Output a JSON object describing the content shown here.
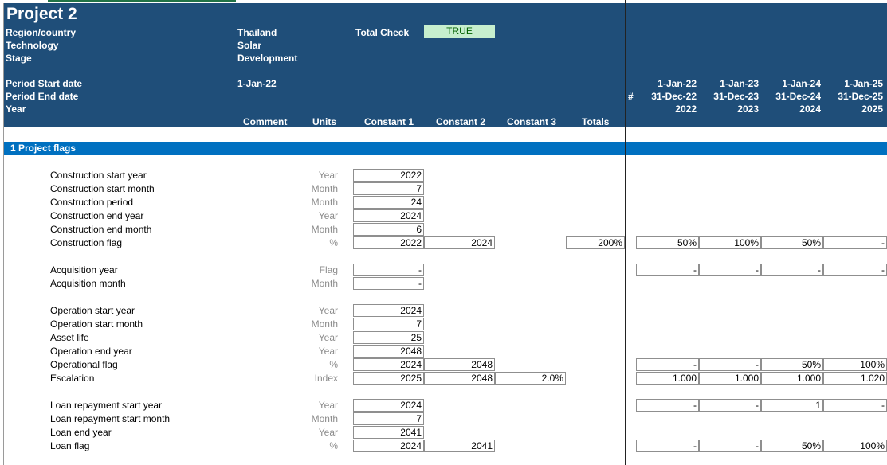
{
  "header": {
    "title": "Project 2",
    "labels": {
      "region": "Region/country",
      "technology": "Technology",
      "stage": "Stage",
      "period_start": "Period Start date",
      "period_end": "Period End date",
      "year": "Year"
    },
    "values": {
      "region": "Thailand",
      "technology": "Solar",
      "stage": "Development",
      "period_start": "1-Jan-22"
    },
    "total_check_label": "Total Check",
    "total_check_value": "TRUE",
    "hash": "#",
    "columns": {
      "comment": "Comment",
      "units": "Units",
      "constant1": "Constant 1",
      "constant2": "Constant 2",
      "constant3": "Constant 3",
      "totals": "Totals"
    },
    "timeline": [
      {
        "start": "1-Jan-22",
        "end": "31-Dec-22",
        "year": "2022"
      },
      {
        "start": "1-Jan-23",
        "end": "31-Dec-23",
        "year": "2023"
      },
      {
        "start": "1-Jan-24",
        "end": "31-Dec-24",
        "year": "2024"
      },
      {
        "start": "1-Jan-25",
        "end": "31-Dec-25",
        "year": "2025"
      }
    ]
  },
  "section": {
    "title": "1 Project flags"
  },
  "rows": {
    "construction_start_year": {
      "label": "Construction start year",
      "unit": "Year",
      "c1": "2022"
    },
    "construction_start_month": {
      "label": "Construction start month",
      "unit": "Month",
      "c1": "7"
    },
    "construction_period": {
      "label": "Construction period",
      "unit": "Month",
      "c1": "24"
    },
    "construction_end_year": {
      "label": "Construction end year",
      "unit": "Year",
      "c1": "2024"
    },
    "construction_end_month": {
      "label": "Construction end month",
      "unit": "Month",
      "c1": "6"
    },
    "construction_flag": {
      "label": "Construction flag",
      "unit": "%",
      "c1": "2022",
      "c2": "2024",
      "total": "200%",
      "t": [
        "50%",
        "100%",
        "50%",
        "-"
      ]
    },
    "acquisition_year": {
      "label": "Acquisition year",
      "unit": "Flag",
      "c1": "-",
      "t": [
        "-",
        "-",
        "-",
        "-"
      ]
    },
    "acquisition_month": {
      "label": "Acquisition month",
      "unit": "Month",
      "c1": "-"
    },
    "operation_start_year": {
      "label": "Operation start year",
      "unit": "Year",
      "c1": "2024"
    },
    "operation_start_month": {
      "label": "Operation start month",
      "unit": "Month",
      "c1": "7"
    },
    "asset_life": {
      "label": "Asset life",
      "unit": "Year",
      "c1": "25"
    },
    "operation_end_year": {
      "label": "Operation end year",
      "unit": "Year",
      "c1": "2048"
    },
    "operational_flag": {
      "label": "Operational flag",
      "unit": "%",
      "c1": "2024",
      "c2": "2048",
      "t": [
        "-",
        "-",
        "50%",
        "100%"
      ]
    },
    "escalation": {
      "label": "Escalation",
      "unit": "Index",
      "c1": "2025",
      "c2": "2048",
      "c3": "2.0%",
      "t": [
        "1.000",
        "1.000",
        "1.000",
        "1.020"
      ]
    },
    "loan_start_year": {
      "label": "Loan repayment start year",
      "unit": "Year",
      "c1": "2024",
      "t": [
        "-",
        "-",
        "1",
        "-"
      ]
    },
    "loan_start_month": {
      "label": "Loan repayment start month",
      "unit": "Month",
      "c1": "7"
    },
    "loan_end_year": {
      "label": "Loan end year",
      "unit": "Year",
      "c1": "2041"
    },
    "loan_flag": {
      "label": "Loan flag",
      "unit": "%",
      "c1": "2024",
      "c2": "2041",
      "t": [
        "-",
        "-",
        "50%",
        "100%"
      ]
    }
  }
}
